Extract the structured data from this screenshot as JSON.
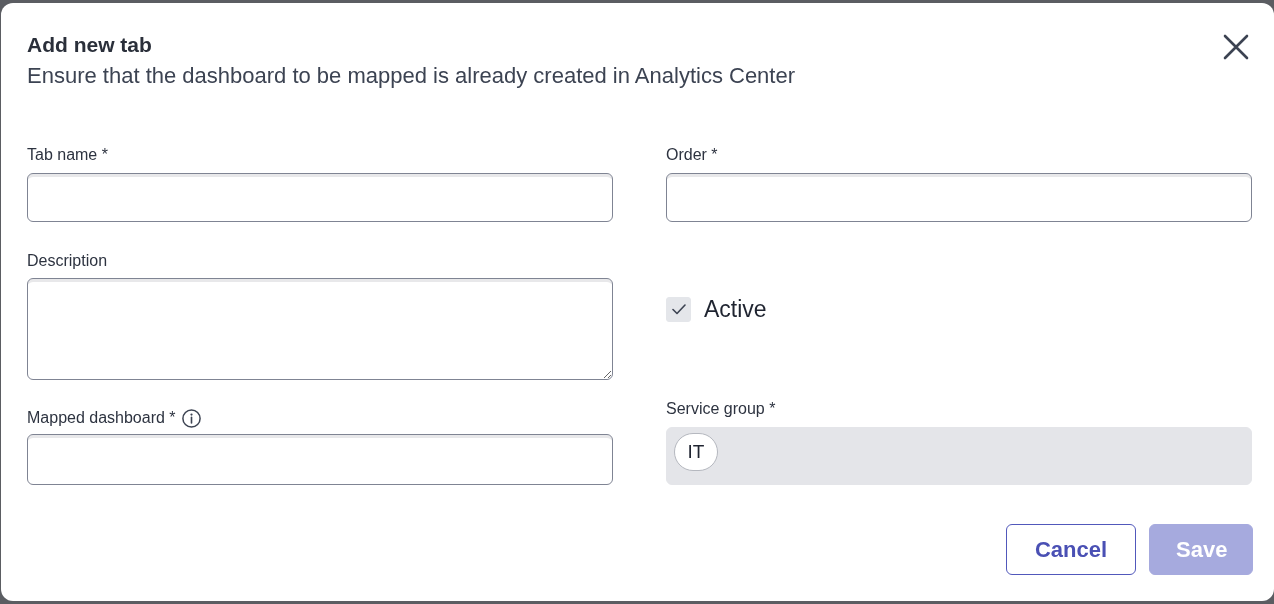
{
  "dialog": {
    "title": "Add new tab",
    "subtitle": "Ensure that the dashboard to be mapped is already created in Analytics Center"
  },
  "fields": [
    {
      "kind": "text",
      "label": "Tab name *"
    },
    {
      "kind": "text",
      "label": "Order *"
    },
    {
      "kind": "textarea",
      "label": "Description"
    },
    {
      "kind": "checkbox",
      "label": "Active",
      "checked": true
    },
    {
      "kind": "text",
      "label": "Mapped dashboard *",
      "info": true
    },
    {
      "kind": "chips",
      "label": "Service group *",
      "disabled": true,
      "chips": [
        "IT"
      ]
    }
  ],
  "buttons": [
    {
      "kind": "secondary",
      "label": "Cancel",
      "disabled": false
    },
    {
      "kind": "primary",
      "label": "Save",
      "disabled": true
    }
  ]
}
